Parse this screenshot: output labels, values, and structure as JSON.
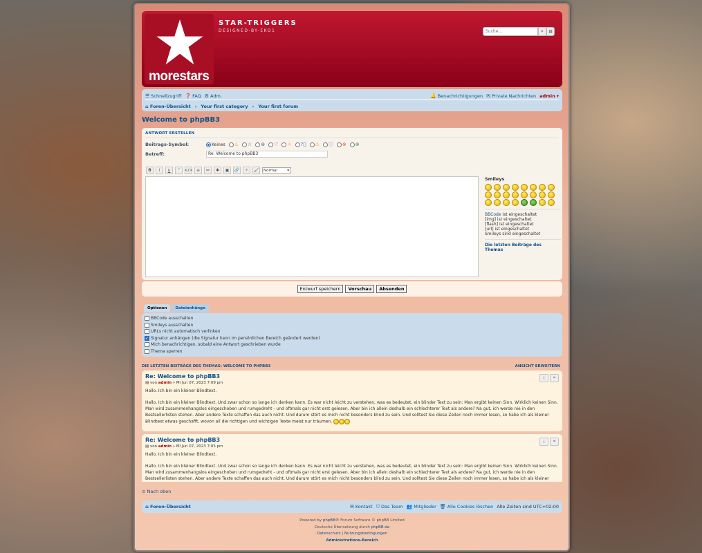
{
  "header": {
    "logo_text": "morestars",
    "site_name": "STAR-TRIGGERS",
    "site_desc": "DESIGNED-BY-EKO1",
    "search_placeholder": "Suche…"
  },
  "navbar": {
    "left": [
      {
        "icon": "bars-icon",
        "label": "Schnellzugriff"
      },
      {
        "icon": "question-icon",
        "label": "FAQ"
      },
      {
        "icon": "cogs-icon",
        "label": "Adm."
      }
    ],
    "right": [
      {
        "icon": "bell-icon",
        "label": "Benachrichtigungen"
      },
      {
        "icon": "inbox-icon",
        "label": "Private Nachrichten"
      },
      {
        "icon": "user-icon",
        "label": "admin"
      }
    ],
    "breadcrumbs": [
      "Foren-Übersicht",
      "Your first category",
      "Your first forum"
    ]
  },
  "topic_title": "Welcome to phpBB3",
  "post_form": {
    "header": "ANTWORT ERSTELLEN",
    "icon_label": "Beitrags-Symbol:",
    "icon_none": "Keines",
    "subject_label": "Betreff:",
    "subject_value": "Re: Welcome to phpBB3",
    "toolbar": [
      "B",
      "i",
      "u",
      "“",
      "</>",
      "≡",
      "≔",
      "✱",
      "▣",
      "🔗",
      "⚡",
      "🖌"
    ],
    "font_size": "Normal",
    "smileys_title": "Smileys",
    "status": {
      "bbcode_link": "BBCode",
      "bbcode": " ist eingeschaltet",
      "img": "[img] ist eingeschaltet",
      "flash": "[flash] ist eingeschaltet",
      "url": "[url] ist eingeschaltet",
      "smileys": "Smileys sind eingeschaltet"
    },
    "last_posts_link": "Die letzten Beiträge des Themas"
  },
  "submit": {
    "draft": "Entwurf speichern",
    "preview": "Vorschau",
    "send": "Absenden"
  },
  "tabs": [
    "Optionen",
    "Dateianhänge"
  ],
  "options": [
    {
      "label": "BBCode ausschalten",
      "checked": false
    },
    {
      "label": "Smileys ausschalten",
      "checked": false
    },
    {
      "label": "URLs nicht automatisch verlinken",
      "checked": false
    },
    {
      "label": "Signatur anhängen (die Signatur kann im persönlichen Bereich geändert werden)",
      "checked": true
    },
    {
      "label": "Mich benachrichtigen, sobald eine Antwort geschrieben wurde",
      "checked": false
    },
    {
      "label": "Thema sperren",
      "checked": false
    }
  ],
  "review": {
    "title": "DIE LETZTEN BEITRÄGE DES THEMAS: WELCOME TO PHPBB3",
    "expand": "ANSICHT ERWEITERN",
    "posts": [
      {
        "title": "Re: Welcome to phpBB3",
        "by": "von",
        "author": "admin",
        "date": "» Mi Jun 07, 2023 7:09 pm",
        "line1": "Hallo. Ich bin ein kleiner Blindtext.",
        "line2": "Hallo. Ich bin ein kleiner Blindtext. Und zwar schon so lange ich denken kann. Es war nicht leicht zu verstehen, was es bedeutet, ein blinder Text zu sein: Man ergibt keinen Sinn. Wirklich keinen Sinn. Man wird zusammenhangslos eingeschoben und rumgedreht - und oftmals gar nicht erst gelesen. Aber bin ich allein deshalb ein schlechterer Text als andere? Na gut, ich werde nie in den Bestsellerlisten stehen. Aber andere Texte schaffen das auch nicht. Und darum stört es mich nicht besonders blind zu sein. Und solltest Sie diese Zeilen noch immer lesen, so habe ich als kleiner Blindtext etwas geschafft, wovon all die richtigen und wichtigen Texte meist nur träumen."
      },
      {
        "title": "Re: Welcome to phpBB3",
        "by": "von",
        "author": "admin",
        "date": "» Mi Jun 07, 2023 7:05 pm",
        "line1": "Hallo. Ich bin ein kleiner Blindtext.",
        "line2": "Hallo. Ich bin ein kleiner Blindtext. Und zwar schon so lange ich denken kann. Es war nicht leicht zu verstehen, was es bedeutet, ein blinder Text zu sein: Man ergibt keinen Sinn. Wirklich keinen Sinn. Man wird zusammenhangslos eingeschoben und rumgedreht - und oftmals gar nicht erst gelesen. Aber bin ich allein deshalb ein schlechterer Text als andere? Na gut, ich werde nie in den Bestsellerlisten stehen. Aber andere Texte schaffen das auch nicht. Und darum stört es mich nicht besonders blind zu sein. Und solltest Sie diese Zeilen noch immer lesen, so habe ich als kleiner Blindtext etwas geschafft, wovon all die richtigen und wichtigen Texte meist nur träumen."
      }
    ]
  },
  "back_to_top": "Nach oben",
  "footer_nav": {
    "home": "Foren-Übersicht",
    "contact": "Kontakt",
    "team": "Das Team",
    "members": "Mitglieder",
    "cookies": "Alle Cookies löschen",
    "timezone": "Alle Zeiten sind UTC+02:00"
  },
  "copyright": {
    "powered_pre": "Powered by ",
    "phpbb": "phpBB",
    "powered_post": "® Forum Software © phpBB Limited",
    "translation_pre": "Deutsche Übersetzung durch ",
    "translation_link": "phpBB.de",
    "privacy": "Datenschutz",
    "sep": " | ",
    "terms": "Nutzungsbedingungen",
    "acp": "Administrations-Bereich"
  }
}
